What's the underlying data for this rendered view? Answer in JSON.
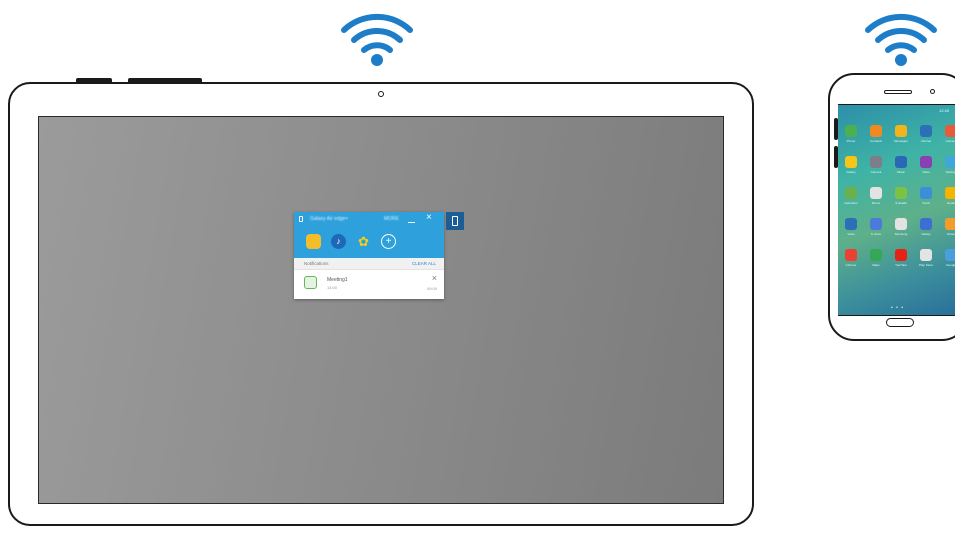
{
  "wifi_icons": [
    "wifi-icon",
    "wifi-icon"
  ],
  "widget": {
    "title": "Galaxy Air edge+",
    "more_label": "MORE",
    "minimize_icon": "minimize-icon",
    "close_icon": "close-icon",
    "apps": [
      {
        "name": "Memo",
        "icon": "memo-icon",
        "color": "#f4bd2a"
      },
      {
        "name": "Music",
        "icon": "music-note-icon",
        "color": "#1d69b8"
      },
      {
        "name": "Gallery",
        "icon": "gallery-icon",
        "color": "#f9cf16"
      },
      {
        "name": "Add",
        "icon": "add-icon",
        "color": "#ffffff"
      }
    ],
    "accent_color": "#2ea1dc",
    "side_tab_icon": "phone-icon",
    "notifications_header": "Notifications",
    "clear_all_label": "CLEAR ALL",
    "notification": {
      "title": "Meeting1",
      "subtitle": "14:00",
      "time": "09:00",
      "icon": "calendar-icon"
    }
  },
  "phone": {
    "status_text": "12:45",
    "apps": [
      {
        "label": "Phone",
        "color": "#4caf50"
      },
      {
        "label": "Contacts",
        "color": "#ef8a20"
      },
      {
        "label": "Messages",
        "color": "#f2b31c"
      },
      {
        "label": "Internet",
        "color": "#2d6fb7"
      },
      {
        "label": "Camera",
        "color": "#e85a3a"
      },
      {
        "label": "Gallery",
        "color": "#f5c518"
      },
      {
        "label": "Camera",
        "color": "#7e7e8a"
      },
      {
        "label": "Music",
        "color": "#2a67b5"
      },
      {
        "label": "Video",
        "color": "#8a3fb3"
      },
      {
        "label": "Settings",
        "color": "#3fa7d9"
      },
      {
        "label": "Calculator",
        "color": "#6ab04c"
      },
      {
        "label": "Memo",
        "color": "#e3e3e3"
      },
      {
        "label": "S Health",
        "color": "#7cc243"
      },
      {
        "label": "Clock",
        "color": "#3a8fd8"
      },
      {
        "label": "Email",
        "color": "#f4b400"
      },
      {
        "label": "Voice",
        "color": "#2d6fb7"
      },
      {
        "label": "S Voice",
        "color": "#4a7bd8"
      },
      {
        "label": "Samsung",
        "color": "#e3e3e3"
      },
      {
        "label": "Galaxy",
        "color": "#3c6fd1"
      },
      {
        "label": "Notes",
        "color": "#f39c2c"
      },
      {
        "label": "Chrome",
        "color": "#e94235"
      },
      {
        "label": "Maps",
        "color": "#34a853"
      },
      {
        "label": "YouTube",
        "color": "#e62117"
      },
      {
        "label": "Play Store",
        "color": "#e3e3e3"
      },
      {
        "label": "Google",
        "color": "#4a9fd8"
      }
    ],
    "page_dots": "• • •"
  }
}
